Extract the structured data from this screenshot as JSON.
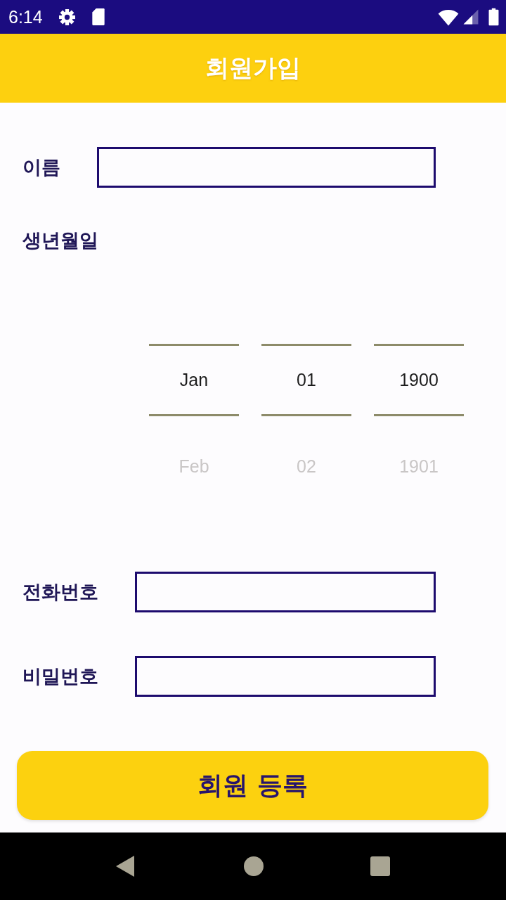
{
  "status_bar": {
    "time": "6:14"
  },
  "app_bar": {
    "title": "회원가입"
  },
  "form": [
    {
      "kind": "input",
      "label": "이름"
    },
    {
      "kind": "date_picker",
      "label": "생년월일",
      "columns": [
        {
          "options": [
            {
              "text": "Jan",
              "selected": true
            },
            {
              "text": "Feb",
              "selected": false
            }
          ]
        },
        {
          "options": [
            {
              "text": "01",
              "selected": true
            },
            {
              "text": "02",
              "selected": false
            }
          ]
        },
        {
          "options": [
            {
              "text": "1900",
              "selected": true
            },
            {
              "text": "1901",
              "selected": false
            }
          ]
        }
      ]
    },
    {
      "kind": "input",
      "label": "전화번호"
    },
    {
      "kind": "input",
      "label": "비밀번호"
    }
  ],
  "submit_button": {
    "label": "회원 등록"
  }
}
